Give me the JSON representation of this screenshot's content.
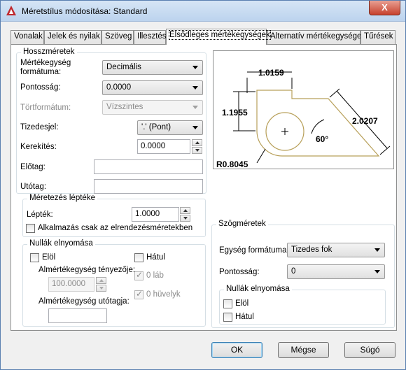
{
  "window": {
    "title": "Méretstílus módosítása: Standard",
    "close_glyph": "X"
  },
  "tabs": [
    "Vonalak",
    "Jelek és nyilak",
    "Szöveg",
    "Illesztés",
    "Elsődleges mértékegységek",
    "Alternatív mértékegységek",
    "Tűrések"
  ],
  "linear": {
    "title": "Hosszméretek",
    "unit_format_label_1": "Mértékegység",
    "unit_format_label_2": "formátuma:",
    "unit_format_value": "Decimális",
    "precision_label": "Pontosság:",
    "precision_value": "0.0000",
    "fraction_label": "Törtformátum:",
    "fraction_value": "Vízszintes",
    "decimal_sep_label": "Tizedesjel:",
    "decimal_sep_value": "'.' (Pont)",
    "round_label": "Kerekítés:",
    "round_value": "0.0000",
    "prefix_label": "Előtag:",
    "prefix_value": "",
    "suffix_label": "Utótag:",
    "suffix_value": ""
  },
  "scale": {
    "title": "Méretezés léptéke",
    "factor_label": "Lépték:",
    "factor_value": "1.0000",
    "layout_only_label": "Alkalmazás csak az elrendezésméretekben"
  },
  "zero_linear": {
    "title": "Nullák elnyomása",
    "leading_label": "Elöl",
    "trailing_label": "Hátul",
    "sub_factor_label": "Almértékegység tényezője:",
    "sub_factor_value": "100.0000",
    "feet_label": "0 láb",
    "inches_label": "0 hüvelyk",
    "sub_suffix_label": "Almértékegység utótagja:",
    "sub_suffix_value": ""
  },
  "angular": {
    "title": "Szögméretek",
    "format_label": "Egység formátuma:",
    "format_value": "Tizedes fok",
    "precision_label": "Pontosság:",
    "precision_value": "0"
  },
  "zero_angular": {
    "title": "Nullák elnyomása",
    "leading_label": "Elöl",
    "trailing_label": "Hátul"
  },
  "preview": {
    "dim_top": "1.0159",
    "dim_left": "1.1955",
    "dim_right": "2.0207",
    "angle": "60°",
    "radius": "R0.8045"
  },
  "buttons": {
    "ok": "OK",
    "cancel": "Mégse",
    "help": "Súgó"
  },
  "colors": {
    "accent": "#3c7fb1",
    "shape": "#b8a05a"
  }
}
